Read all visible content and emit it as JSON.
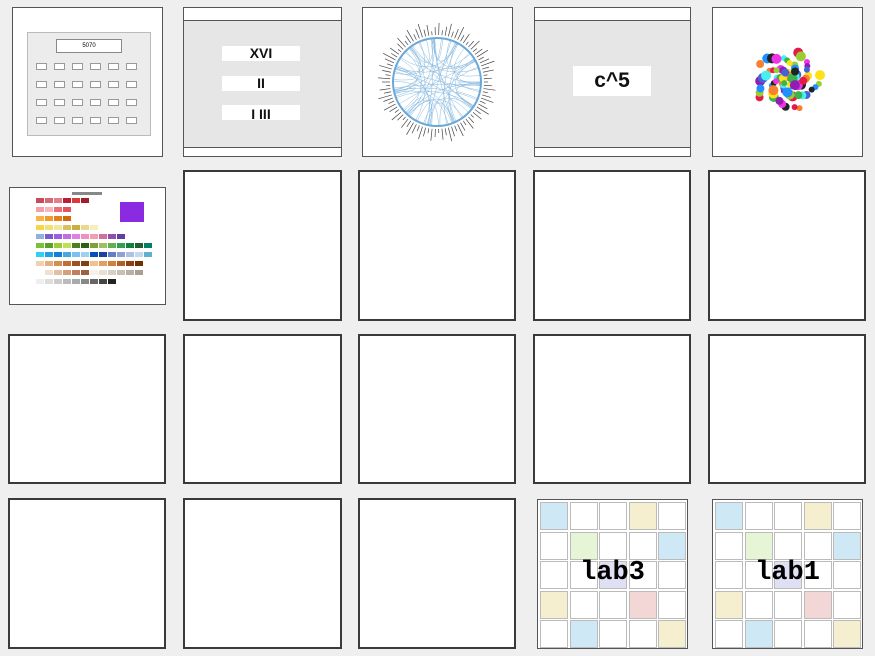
{
  "tiles": {
    "calculator": {
      "display": "5070"
    },
    "roman": {
      "labels": [
        "XVI",
        "II",
        "I III"
      ]
    },
    "power": {
      "label": "c^5"
    },
    "palette": {
      "accent": "#8a2be2"
    },
    "lab3": {
      "label": "lab3"
    },
    "lab1": {
      "label": "lab1"
    }
  },
  "colors": {
    "background": "#efefef",
    "tile_border": "#3a3a3a",
    "web_blue": "#6aa8d8"
  }
}
